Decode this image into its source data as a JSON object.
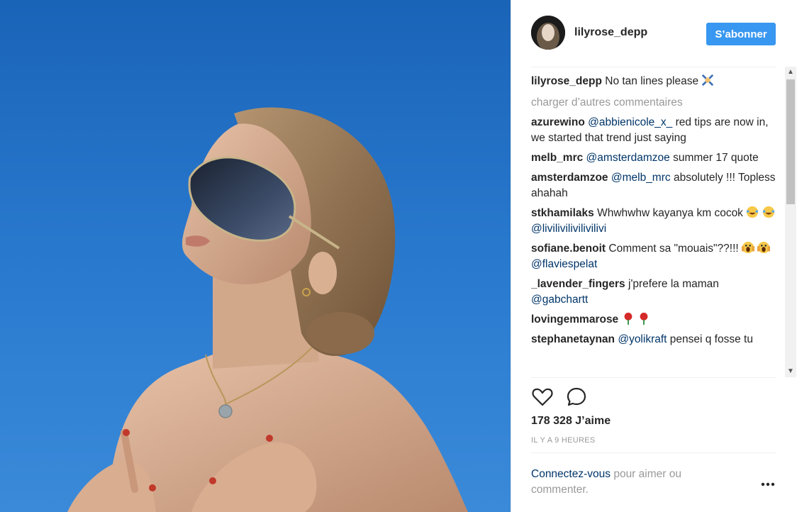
{
  "post": {
    "username": "lilyrose_depp",
    "follow_label": "S’abonner",
    "caption": "No tan lines please",
    "load_more": "charger d’autres commentaires",
    "comments": [
      {
        "author": "azurewino",
        "mention": "@abbienicole_x_",
        "text": " red tips are now in, we started that trend just saying"
      },
      {
        "author": "melb_mrc",
        "mention": "@amsterdamzoe",
        "text": " summer 17 quote"
      },
      {
        "author": "amsterdamzoe",
        "mention": "@melb_mrc",
        "text": " absolutely !!! Topless ahahah"
      },
      {
        "author": "stkhamilaks",
        "text": "Whwhwhw kayanya km cocok",
        "mention": "@livilivilivilivilivi"
      },
      {
        "author": "sofiane.benoit",
        "text": "Comment sa \"mouais\"??!!!",
        "mention": "@flaviespelat"
      },
      {
        "author": "_lavender_fingers",
        "text": "j'prefere la maman",
        "mention": "@gabchartt"
      },
      {
        "author": "lovingemmarose",
        "text": ""
      },
      {
        "author": "stephanetaynan",
        "mention": "@yolikraft",
        "text": " pensei q fosse tu"
      }
    ],
    "likes": "178 328 J’aime",
    "time": "IL Y A 9 HEURES",
    "login_link": "Connectez-vous",
    "login_text": " pour aimer ou commenter."
  },
  "colors": {
    "accent": "#3897f0",
    "mention": "#003569",
    "sky": "#2a7bd0"
  },
  "icons": [
    "heart-icon",
    "comment-icon",
    "more-icon",
    "dancers-emoji",
    "laughing-emoji",
    "scream-emoji",
    "rose-emoji"
  ]
}
